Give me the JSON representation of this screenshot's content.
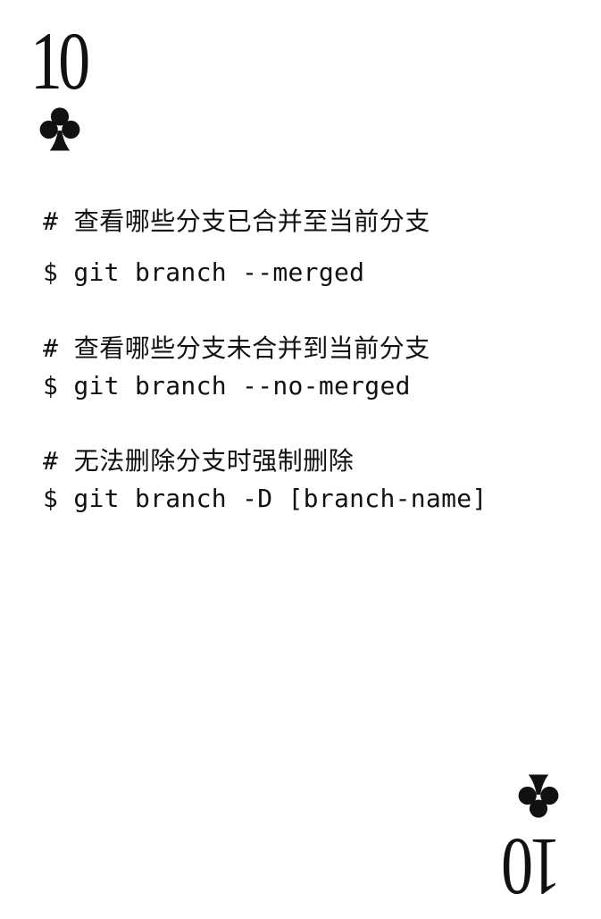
{
  "card": {
    "rank": "10",
    "suit": "club",
    "suit_icon": "club-icon"
  },
  "lines": [
    {
      "type": "comment",
      "text": "# 查看哪些分支已合并至当前分支"
    },
    {
      "type": "command",
      "text": "$ git branch --merged"
    },
    {
      "type": "comment",
      "text": "# 查看哪些分支未合并到当前分支"
    },
    {
      "type": "command",
      "text": "$ git branch --no-merged"
    },
    {
      "type": "comment",
      "text": "# 无法删除分支时强制删除"
    },
    {
      "type": "command",
      "text": "$ git branch -D [branch-name]"
    }
  ]
}
